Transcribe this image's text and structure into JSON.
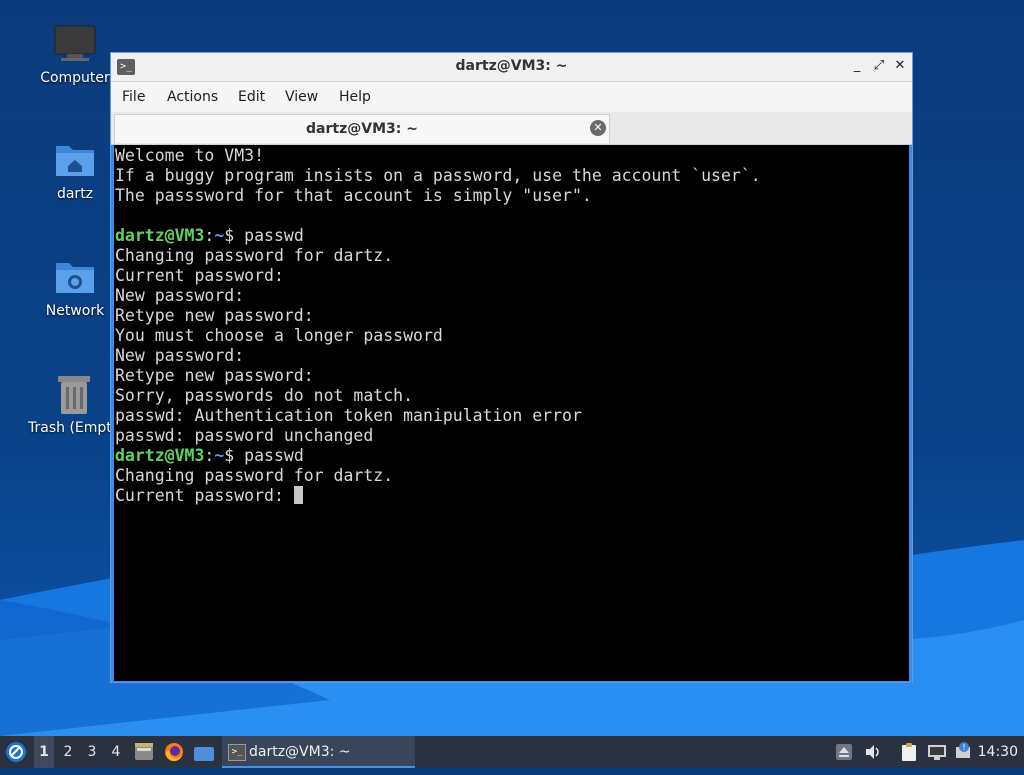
{
  "desktop": {
    "icons": [
      {
        "label": "Computer"
      },
      {
        "label": "dartz"
      },
      {
        "label": "Network"
      },
      {
        "label": "Trash (Empty)"
      }
    ]
  },
  "window": {
    "title": "dartz@VM3: ~",
    "app_icon": "terminal-icon",
    "controls": {
      "minimize": "_",
      "maximize": "⤢",
      "close": "✕"
    },
    "menu": [
      "File",
      "Actions",
      "Edit",
      "View",
      "Help"
    ],
    "tab": {
      "title": "dartz@VM3: ~",
      "close_icon": "close-circle-icon"
    }
  },
  "terminal": {
    "colors": {
      "user": "#5fd35f",
      "path": "#6b8cff",
      "text": "#d8d8d8"
    },
    "prompt": {
      "user_host": "dartz@VM3",
      "colon": ":",
      "path": "~",
      "symbol": "$ "
    },
    "lines": [
      {
        "text": "Welcome to VM3!"
      },
      {
        "text": "If a buggy program insists on a password, use the account `user`."
      },
      {
        "text": "The passsword for that account is simply \"user\"."
      },
      {
        "text": ""
      },
      {
        "prompt": true,
        "text": "passwd"
      },
      {
        "text": "Changing password for dartz."
      },
      {
        "text": "Current password:"
      },
      {
        "text": "New password:"
      },
      {
        "text": "Retype new password:"
      },
      {
        "text": "You must choose a longer password"
      },
      {
        "text": "New password:"
      },
      {
        "text": "Retype new password:"
      },
      {
        "text": "Sorry, passwords do not match."
      },
      {
        "text": "passwd: Authentication token manipulation error"
      },
      {
        "text": "passwd: password unchanged"
      },
      {
        "prompt": true,
        "text": "passwd"
      },
      {
        "text": "Changing password for dartz."
      },
      {
        "text": "Current password: ",
        "cursor": true
      }
    ]
  },
  "taskbar": {
    "start_icon": "lubuntu-logo-icon",
    "workspaces": [
      "1",
      "2",
      "3",
      "4"
    ],
    "active_workspace": "1",
    "launchers": [
      "file-manager-icon",
      "firefox-icon",
      "show-desktop-icon"
    ],
    "task": {
      "label": "dartz@VM3: ~",
      "icon": "terminal-icon"
    },
    "tray": [
      "eject-icon",
      "volume-icon",
      "clipboard-icon",
      "network-icon",
      "update-notifier-icon"
    ],
    "clock": "14:30"
  }
}
